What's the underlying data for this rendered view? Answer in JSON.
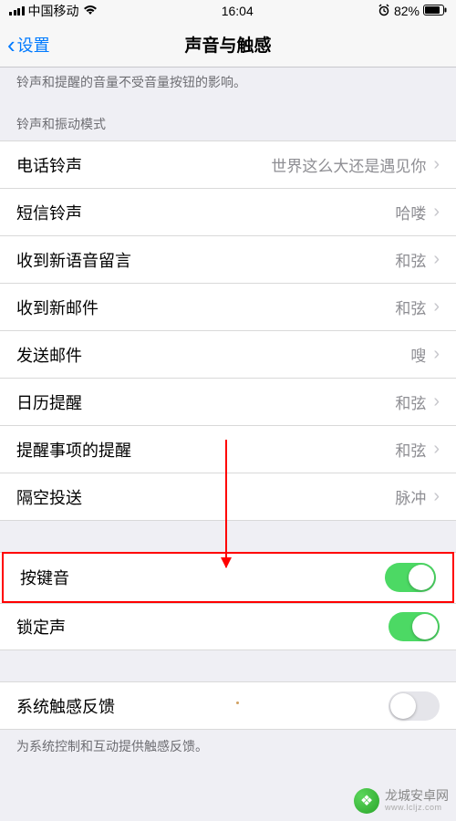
{
  "status": {
    "carrier": "中国移动",
    "time": "16:04",
    "battery": "82%"
  },
  "nav": {
    "back": "设置",
    "title": "声音与触感"
  },
  "hints": {
    "top": "铃声和提醒的音量不受音量按钮的影响。",
    "section": "铃声和振动模式",
    "footer": "为系统控制和互动提供触感反馈。"
  },
  "rows": {
    "ringtone": {
      "label": "电话铃声",
      "value": "世界这么大还是遇见你"
    },
    "text_tone": {
      "label": "短信铃声",
      "value": "哈喽"
    },
    "voicemail": {
      "label": "收到新语音留言",
      "value": "和弦"
    },
    "new_mail": {
      "label": "收到新邮件",
      "value": "和弦"
    },
    "sent_mail": {
      "label": "发送邮件",
      "value": "嗖"
    },
    "calendar": {
      "label": "日历提醒",
      "value": "和弦"
    },
    "reminder": {
      "label": "提醒事项的提醒",
      "value": "和弦"
    },
    "airdrop": {
      "label": "隔空投送",
      "value": "脉冲"
    },
    "keyboard_clicks": {
      "label": "按键音"
    },
    "lock_sound": {
      "label": "锁定声"
    },
    "system_haptics": {
      "label": "系统触感反馈"
    }
  },
  "watermark": {
    "name": "龙城安卓网",
    "url": "www.lcljz.com"
  }
}
